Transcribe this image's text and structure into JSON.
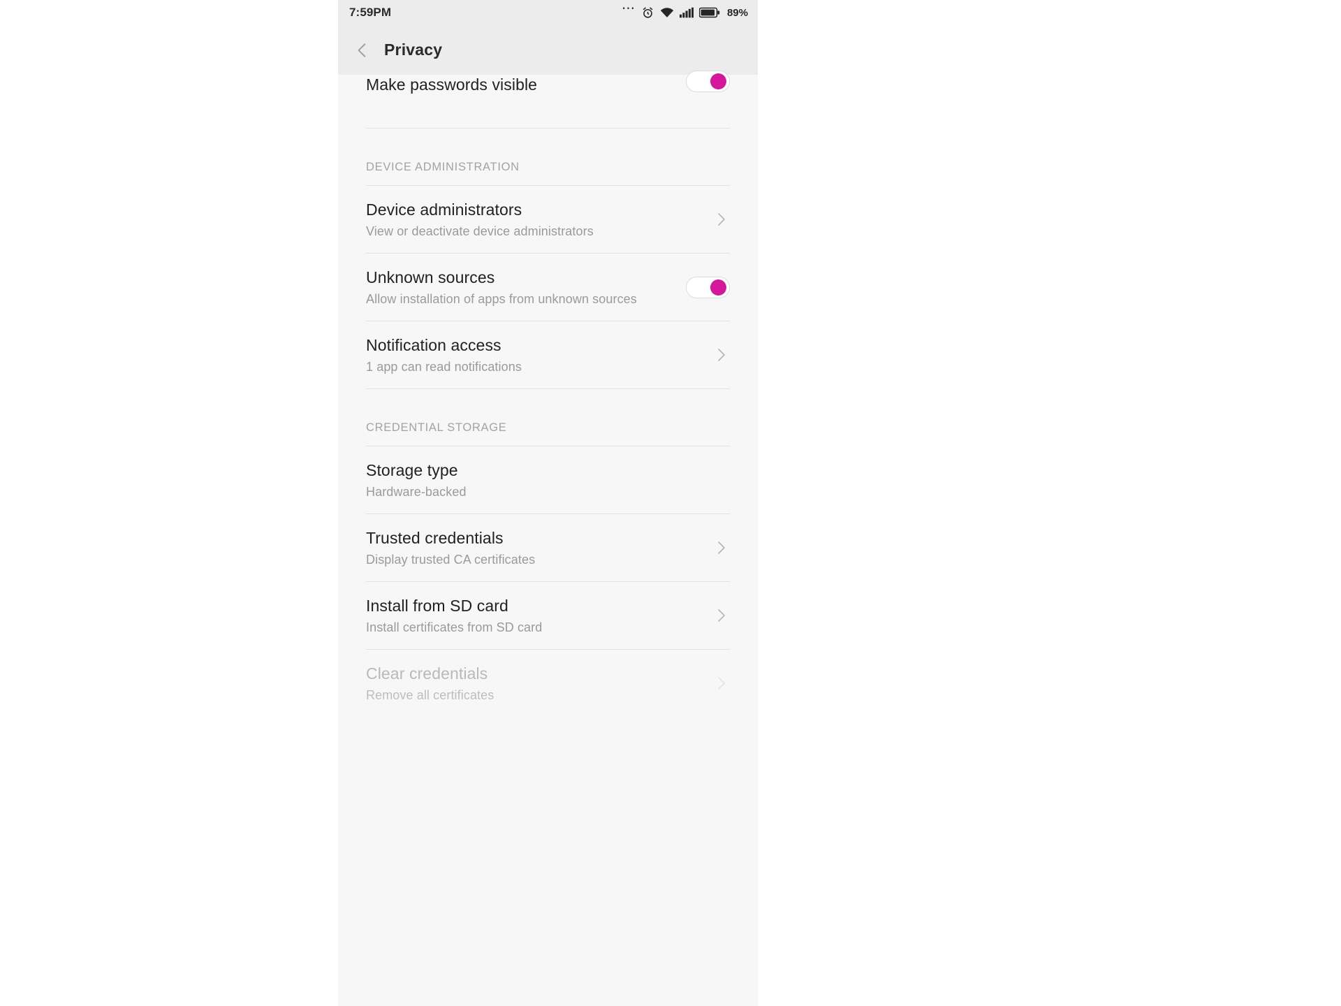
{
  "status_bar": {
    "time": "7:59PM",
    "icons": [
      "more-dots-icon",
      "alarm-icon",
      "wifi-icon",
      "signal-icon",
      "battery-icon"
    ],
    "battery_percent": "89%"
  },
  "action_bar": {
    "back_icon": "chevron-left-icon",
    "title": "Privacy"
  },
  "colors": {
    "accent": "#d5179b",
    "status_bar_bg": "#ececec",
    "list_bg": "#f7f7f7",
    "title_text": "#212121",
    "subtitle_text": "#9a9a9a",
    "disabled_text": "#b9b9b9",
    "divider": "#e2e2e2"
  },
  "rows": [
    {
      "id": "make-passwords-visible",
      "title": "Make passwords visible",
      "subtitle": "",
      "control": "switch",
      "checked": true,
      "disabled": false
    }
  ],
  "sections": [
    {
      "id": "device-administration",
      "header": "DEVICE ADMINISTRATION",
      "items": [
        {
          "id": "device-administrators",
          "title": "Device administrators",
          "subtitle": "View or deactivate device administrators",
          "control": "chevron",
          "disabled": false
        },
        {
          "id": "unknown-sources",
          "title": "Unknown sources",
          "subtitle": "Allow installation of apps from unknown sources",
          "control": "switch",
          "checked": true,
          "disabled": false
        },
        {
          "id": "notification-access",
          "title": "Notification access",
          "subtitle": "1 app can read notifications",
          "control": "chevron",
          "disabled": false
        }
      ]
    },
    {
      "id": "credential-storage",
      "header": "CREDENTIAL STORAGE",
      "items": [
        {
          "id": "storage-type",
          "title": "Storage type",
          "subtitle": "Hardware-backed",
          "control": "none",
          "disabled": false
        },
        {
          "id": "trusted-credentials",
          "title": "Trusted credentials",
          "subtitle": "Display trusted CA certificates",
          "control": "chevron",
          "disabled": false
        },
        {
          "id": "install-from-sd-card",
          "title": "Install from SD card",
          "subtitle": "Install certificates from SD card",
          "control": "chevron",
          "disabled": false
        },
        {
          "id": "clear-credentials",
          "title": "Clear credentials",
          "subtitle": "Remove all certificates",
          "control": "chevron",
          "disabled": true
        }
      ]
    }
  ]
}
